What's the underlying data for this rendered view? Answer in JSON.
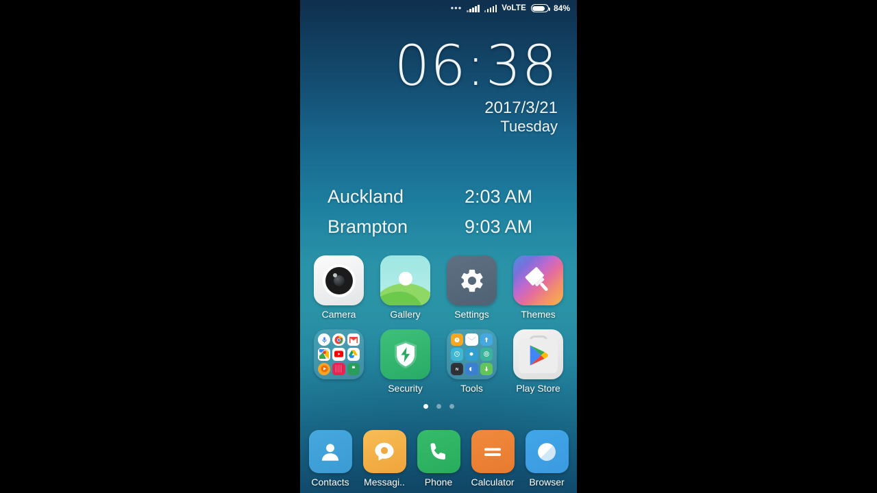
{
  "status_bar": {
    "more_icon": "more-dots-icon",
    "sim1_signal_icon": "signal-bars-icon",
    "sim2_signal_icon": "signal-bars-icon",
    "network_label": "VoLTE",
    "battery_icon": "battery-icon",
    "battery_percent": "84%",
    "battery_level": 84
  },
  "clock_widget": {
    "time": "06:38",
    "date": "2017/3/21",
    "weekday": "Tuesday"
  },
  "world_clock": {
    "rows": [
      {
        "city": "Auckland",
        "time": "2:03 AM"
      },
      {
        "city": "Brampton",
        "time": "9:03 AM"
      }
    ]
  },
  "home_screen": {
    "rows": [
      [
        {
          "label": "Camera",
          "icon": "camera-icon"
        },
        {
          "label": "Gallery",
          "icon": "gallery-icon"
        },
        {
          "label": "Settings",
          "icon": "settings-gear-icon"
        },
        {
          "label": "Themes",
          "icon": "themes-paintbrush-icon"
        }
      ],
      [
        {
          "label": "",
          "icon": "google-folder-icon"
        },
        {
          "label": "Security",
          "icon": "security-shield-icon"
        },
        {
          "label": "Tools",
          "icon": "tools-folder-icon"
        },
        {
          "label": "Play Store",
          "icon": "play-store-icon"
        }
      ]
    ],
    "page_dots": {
      "count": 3,
      "active_index": 0
    }
  },
  "dock": {
    "items": [
      {
        "label": "Contacts",
        "icon": "contacts-person-icon"
      },
      {
        "label": "Messagi..",
        "icon": "messaging-bubble-icon"
      },
      {
        "label": "Phone",
        "icon": "phone-handset-icon"
      },
      {
        "label": "Calculator",
        "icon": "calculator-equals-icon"
      },
      {
        "label": "Browser",
        "icon": "browser-compass-icon"
      }
    ]
  },
  "colors": {
    "wallpaper_top": "#0f2f4d",
    "wallpaper_mid": "#2b93a6",
    "wallpaper_bottom": "#124f72",
    "letterbox": "#000000",
    "text_primary": "#ffffff",
    "security_green": "#2fb570",
    "phone_green": "#2fb464",
    "calculator_orange": "#ee7f32",
    "messaging_orange": "#f3ad44",
    "contacts_blue": "#3f9fd6",
    "browser_blue": "#3ea0e4"
  }
}
